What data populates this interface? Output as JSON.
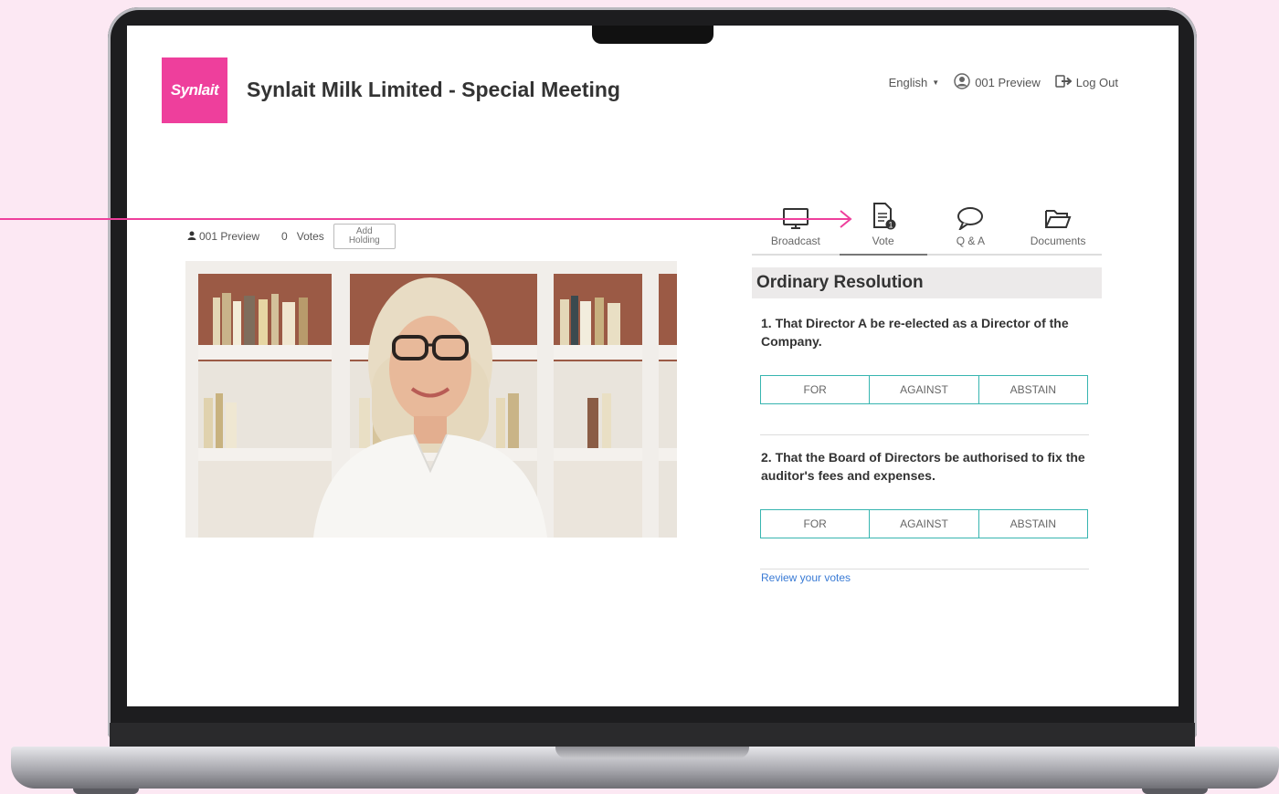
{
  "app": {
    "logo_text": "Synlait",
    "title": "Synlait Milk Limited - Special Meeting",
    "brand_color": "#ee3f9c"
  },
  "topnav": {
    "language": "English",
    "user": "001 Preview",
    "logout": "Log Out"
  },
  "video_bar": {
    "user": "001 Preview",
    "votes_count": "0",
    "votes_label": "Votes",
    "add_holding": "Add Holding"
  },
  "tabs": [
    {
      "label": "Broadcast",
      "icon": "monitor-icon"
    },
    {
      "label": "Vote",
      "icon": "document-icon",
      "badge": "1",
      "active": true
    },
    {
      "label": "Q & A",
      "icon": "speech-bubble-icon"
    },
    {
      "label": "Documents",
      "icon": "folder-open-icon"
    }
  ],
  "voting": {
    "section_title": "Ordinary Resolution",
    "accent_color": "#37b5b0",
    "resolutions": [
      {
        "text": "1. That Director A be re-elected as a Director of the Company."
      },
      {
        "text": "2. That the Board of Directors be authorised to fix the auditor's fees and expenses."
      }
    ],
    "options": [
      "FOR",
      "AGAINST",
      "ABSTAIN"
    ],
    "review_link": "Review your votes"
  },
  "annotation": {
    "arrow_color": "#ee3f9c"
  }
}
